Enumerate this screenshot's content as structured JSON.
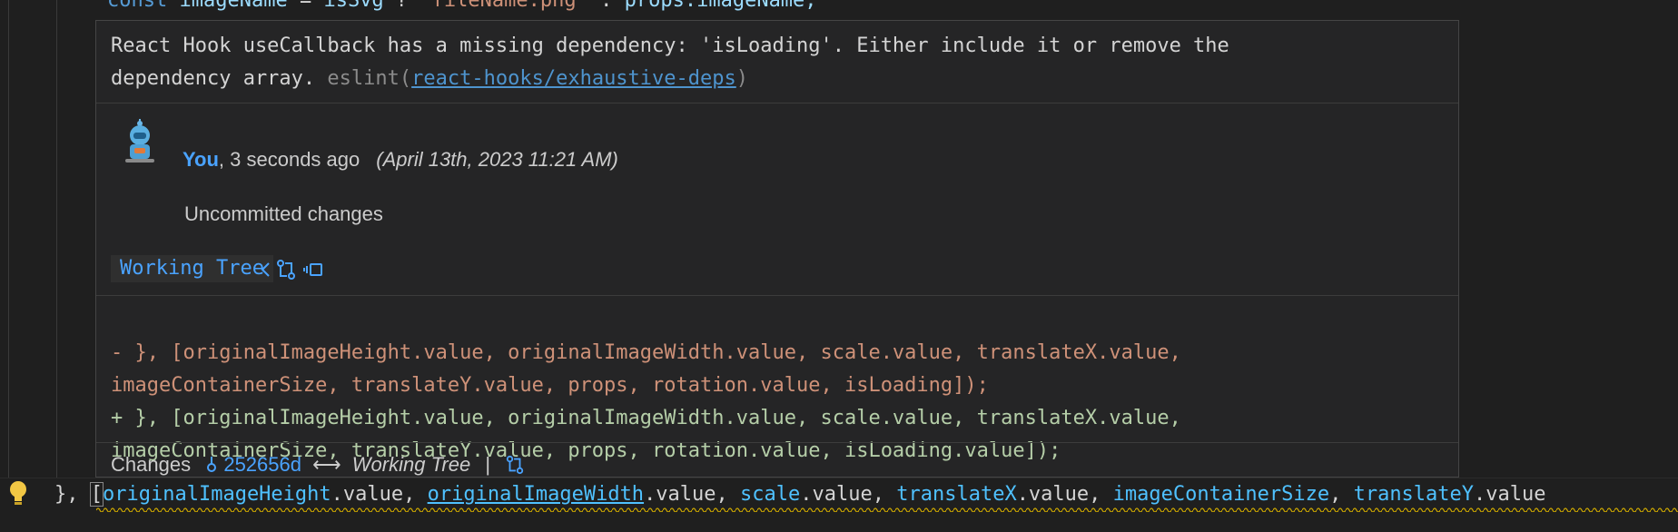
{
  "editor": {
    "top_code": {
      "kw": "const",
      "name": "imageName",
      "eq": " = ",
      "cond": "isSvg",
      "q": " ? ",
      "str": "'fileName.png'",
      "colon": " : ",
      "rest": "props.imageName;"
    },
    "bottom_code": {
      "prefix": "}, ",
      "bracket": "[",
      "t1": "originalImageHeight",
      "t2": ".value, ",
      "t3": "originalImageWidth",
      "t4": ".value, ",
      "t5": "scale",
      "t6": ".value, ",
      "t7": "translateX",
      "t8": ".value, ",
      "t9": "imageContainerSize",
      "t10": ", ",
      "t11": "translateY",
      "t12": ".value"
    }
  },
  "hover": {
    "message_line1": "React Hook useCallback has a missing dependency: 'isLoading'. Either include it or remove the",
    "message_line2": "dependency array. ",
    "eslint_prefix": "eslint(",
    "eslint_rule": "react-hooks/exhaustive-deps",
    "eslint_suffix": ")",
    "blame": {
      "author": "You",
      "relative_time": ", 3 seconds ago",
      "date": "(April 13th, 2023 11:21 AM)",
      "message": "Uncommitted changes",
      "badge": "Working Tree"
    },
    "diff": {
      "removed_1": "- }, [originalImageHeight.value, originalImageWidth.value, scale.value, translateX.value,",
      "removed_2": "imageContainerSize, translateY.value, props, rotation.value, isLoading]);",
      "added_1": "+ }, [originalImageHeight.value, originalImageWidth.value, scale.value, translateX.value,",
      "added_2": "imageContainerSize, translateY.value, props, rotation.value, isLoading.value]);"
    },
    "changes": {
      "label": "Changes",
      "hash": "252656d",
      "arrow": "⟷",
      "target": "Working Tree",
      "pipe": "|"
    }
  },
  "colors": {
    "accent_blue": "#4aa3ff",
    "deleted": "#ce9178",
    "added": "#b5cea8",
    "warning": "#cca700"
  }
}
